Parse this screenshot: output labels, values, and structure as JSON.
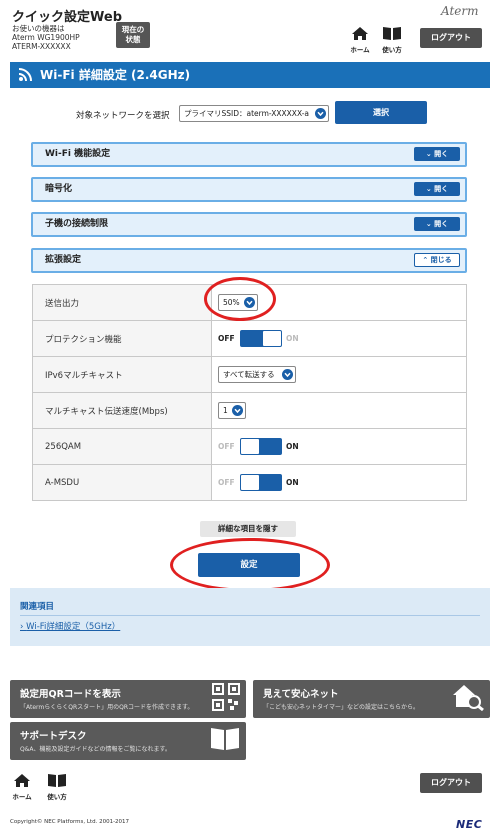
{
  "header": {
    "app_title": "クイック設定Web",
    "model_line1": "お使いの機器は",
    "model_line2": "Aterm WG1900HP",
    "model_line3": "ATERM-XXXXXX",
    "status_button": "現在の\n状態",
    "brand": "Aterm",
    "home_label": "ホーム",
    "guide_label": "使い方",
    "logout_label": "ログアウト"
  },
  "section": {
    "title": "Wi-Fi 詳細設定 (2.4GHz)"
  },
  "network_select": {
    "label": "対象ネットワークを選択",
    "selected": "プライマリSSID：aterm-XXXXXX-a",
    "button": "選択"
  },
  "accordions": [
    {
      "label": "Wi-Fi 機能設定",
      "button": "開く"
    },
    {
      "label": "暗号化",
      "button": "開く"
    },
    {
      "label": "子機の接続制限",
      "button": "開く"
    },
    {
      "label": "拡張設定",
      "button": "閉じる"
    }
  ],
  "settings": {
    "tx_power": {
      "label": "送信出力",
      "value": "50%"
    },
    "protection": {
      "label": "プロテクション機能",
      "off": "OFF",
      "on": "ON",
      "state": "off"
    },
    "ipv6_multicast": {
      "label": "IPv6マルチキャスト",
      "value": "すべて転送する"
    },
    "multicast_rate": {
      "label": "マルチキャスト伝送速度(Mbps)",
      "value": "1"
    },
    "qam256": {
      "label": "256QAM",
      "off": "OFF",
      "on": "ON",
      "state": "on"
    },
    "amsdu": {
      "label": "A-MSDU",
      "off": "OFF",
      "on": "ON",
      "state": "on"
    }
  },
  "actions": {
    "hide_details": "詳細な項目を隠す",
    "apply": "設定"
  },
  "related": {
    "heading": "関連項目",
    "link": "Wi-Fi詳細設定（5GHz）"
  },
  "cards": {
    "qr": {
      "title": "設定用QRコードを表示",
      "sub": "「AtermらくらくQRスタート」用のQRコードを作成できます。"
    },
    "mieru": {
      "title": "見えて安心ネット",
      "sub": "「こども安心ネットタイマー」などの設定はこちらから。"
    },
    "support": {
      "title": "サポートデスク",
      "sub": "Q&A、機能及設定ガイドなどの情報をご覧になれます。"
    }
  },
  "footer": {
    "home_label": "ホーム",
    "guide_label": "使い方",
    "logout_label": "ログアウト",
    "copyright": "Copyright© NEC Platforms, Ltd. 2001-2017",
    "company_logo": "NEC"
  },
  "colors": {
    "primary": "#1a5fa8",
    "title_bar": "#1a70b8",
    "accordion_bg": "#e3f0fb",
    "highlight_ring": "#e02020"
  }
}
